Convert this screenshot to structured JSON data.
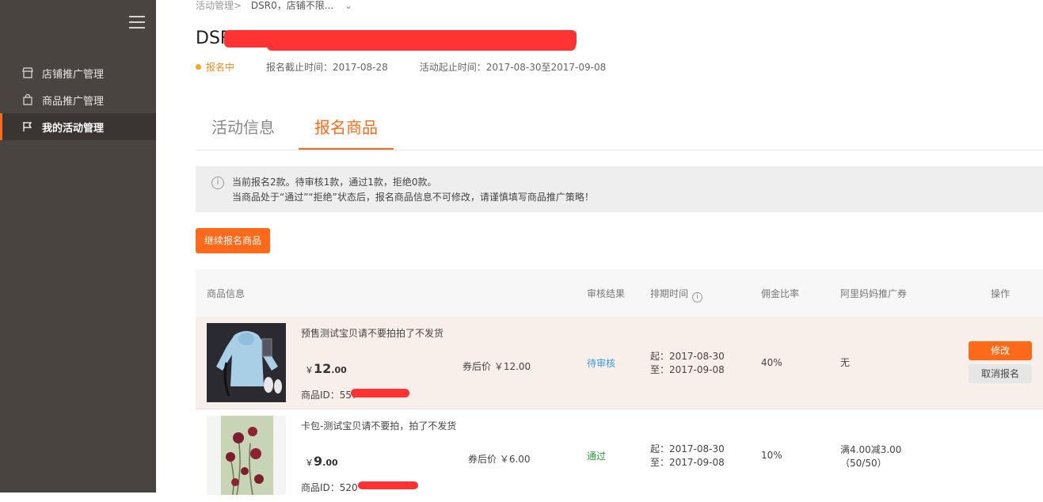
{
  "sidebar": {
    "items": [
      {
        "label": "店铺推广管理",
        "icon": "store-icon"
      },
      {
        "label": "商品推广管理",
        "icon": "bag-icon"
      },
      {
        "label": "我的活动管理",
        "icon": "flag-icon",
        "active": true
      }
    ]
  },
  "breadcrumb": {
    "parent": "活动管理>",
    "current": "DSR0，店铺不限..."
  },
  "page": {
    "title": "DSR0"
  },
  "meta": {
    "status": "报名中",
    "deadline": "报名截止时间：2017-08-28",
    "period": "活动起止时间：2017-08-30至2017-09-08"
  },
  "tabs": [
    {
      "label": "活动信息"
    },
    {
      "label": "报名商品",
      "active": true
    }
  ],
  "notice": {
    "line1": "当前报名2款。待审核1款，通过1款，拒绝0款。",
    "line2": "当商品处于“通过”“拒绝”状态后，报名商品信息不可修改，请谨慎填写商品推广策略！"
  },
  "actions": {
    "continue": "继续报名商品"
  },
  "table": {
    "headers": {
      "product": "商品信息",
      "audit": "审核结果",
      "schedule": "排期时间",
      "commission": "佣金比率",
      "coupon": "阿里妈妈推广券",
      "ops": "操作"
    },
    "rows": [
      {
        "name": "预售测试宝贝请不要拍拍了不发货",
        "price_currency": "￥",
        "price_int": "12",
        "price_dec": ".00",
        "coupon_price": "券后价 ￥12.00",
        "id": "商品ID：557",
        "audit": "待审核",
        "audit_color": "#3a9bd9",
        "start": "起：2017-08-30",
        "end": "至：2017-09-08",
        "rate": "40%",
        "ticket_line1": "无",
        "ticket_line2": "",
        "edit": "修改",
        "cancel": "取消报名"
      },
      {
        "name": "卡包-测试宝贝请不要拍，拍了不发货",
        "price_currency": "￥",
        "price_int": "9",
        "price_dec": ".00",
        "coupon_price": "券后价 ￥6.00",
        "id": "商品ID：520",
        "audit": "通过",
        "audit_color": "#2e9a3a",
        "start": "起：2017-08-30",
        "end": "至：2017-09-08",
        "rate": "10%",
        "ticket_line1": "满4.00减3.00",
        "ticket_line2": "（50/50）"
      }
    ]
  }
}
